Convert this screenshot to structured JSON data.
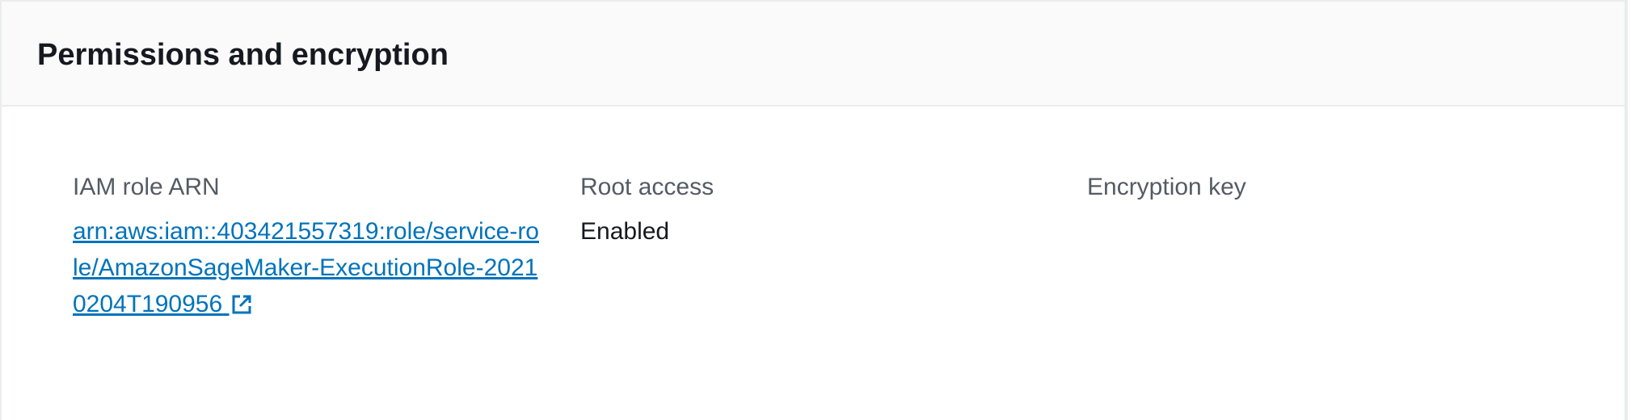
{
  "section": {
    "title": "Permissions and encryption"
  },
  "fields": {
    "iam_role": {
      "label": "IAM role ARN",
      "value": "arn:aws:iam::403421557319:role/service-role/AmazonSageMaker-ExecutionRole-20210204T190956"
    },
    "root_access": {
      "label": "Root access",
      "value": "Enabled"
    },
    "encryption_key": {
      "label": "Encryption key",
      "value": ""
    }
  },
  "icons": {
    "external_link": "external-link-icon"
  },
  "colors": {
    "link": "#0073bb",
    "label": "#545b64",
    "text": "#16191f",
    "header_bg": "#fafafa",
    "border": "#eaeded"
  }
}
